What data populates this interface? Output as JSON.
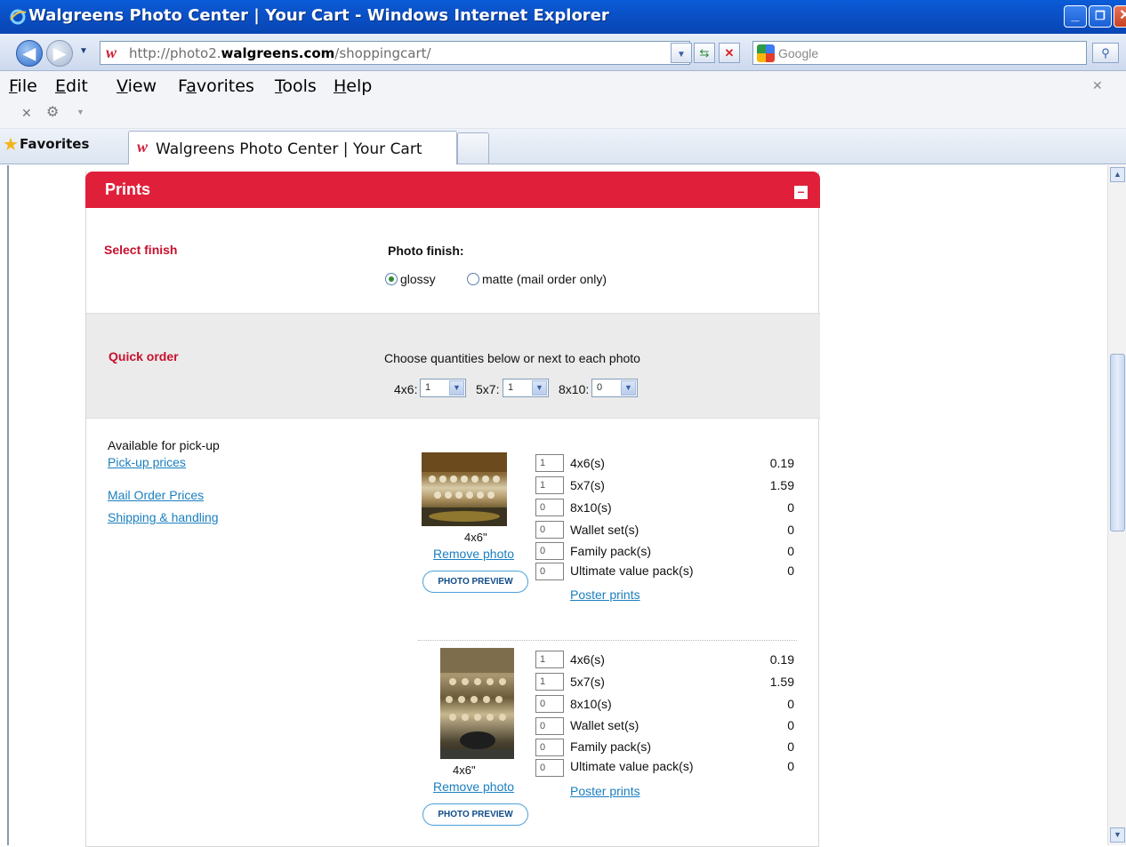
{
  "window": {
    "title": "Walgreens Photo Center | Your Cart - Windows Internet Explorer",
    "controls": {
      "minimize": "_",
      "maximize": "❐",
      "close": "✕"
    }
  },
  "address_bar": {
    "url_prefix": "http://photo2.",
    "url_domain": "walgreens.com",
    "url_path": "/shoppingcart/",
    "search_placeholder": "Google"
  },
  "menu": [
    "File",
    "Edit",
    "View",
    "Favorites",
    "Tools",
    "Help"
  ],
  "favorites_bar": {
    "label": "Favorites",
    "tab_title": "Walgreens Photo Center | Your Cart"
  },
  "panel": {
    "title": "Prints",
    "finish": {
      "heading": "Select finish",
      "label": "Photo finish:",
      "options": [
        {
          "label": "glossy",
          "selected": true
        },
        {
          "label": "matte (mail order only)",
          "selected": false
        }
      ]
    },
    "quick_order": {
      "heading": "Quick order",
      "instruction": "Choose quantities below or next to each photo",
      "selectors": [
        {
          "label": "4x6:",
          "value": "1"
        },
        {
          "label": "5x7:",
          "value": "1"
        },
        {
          "label": "8x10:",
          "value": "0"
        }
      ]
    },
    "side_links": {
      "availability": "Available for pick-up",
      "pickup_prices": "Pick-up prices",
      "mail_order_prices": "Mail Order Prices",
      "shipping": "Shipping & handling"
    },
    "photos": [
      {
        "size_label": "4x6\"",
        "remove_label": "Remove photo",
        "preview_label": "PHOTO PREVIEW",
        "poster_label": "Poster prints",
        "items": [
          {
            "qty": "1",
            "label": "4x6(s)",
            "price": "0.19"
          },
          {
            "qty": "1",
            "label": "5x7(s)",
            "price": "1.59"
          },
          {
            "qty": "0",
            "label": "8x10(s)",
            "price": "0"
          },
          {
            "qty": "0",
            "label": "Wallet set(s)",
            "price": "0"
          },
          {
            "qty": "0",
            "label": "Family pack(s)",
            "price": "0"
          },
          {
            "qty": "0",
            "label": "Ultimate value pack(s)",
            "price": "0"
          }
        ]
      },
      {
        "size_label": "4x6\"",
        "remove_label": "Remove photo",
        "preview_label": "PHOTO PREVIEW",
        "poster_label": "Poster prints",
        "items": [
          {
            "qty": "1",
            "label": "4x6(s)",
            "price": "0.19"
          },
          {
            "qty": "1",
            "label": "5x7(s)",
            "price": "1.59"
          },
          {
            "qty": "0",
            "label": "8x10(s)",
            "price": "0"
          },
          {
            "qty": "0",
            "label": "Wallet set(s)",
            "price": "0"
          },
          {
            "qty": "0",
            "label": "Family pack(s)",
            "price": "0"
          },
          {
            "qty": "0",
            "label": "Ultimate value pack(s)",
            "price": "0"
          }
        ]
      }
    ]
  },
  "colors": {
    "brand_red": "#e0203a",
    "heading_red": "#c8102e",
    "link_blue": "#1a7fbf"
  }
}
